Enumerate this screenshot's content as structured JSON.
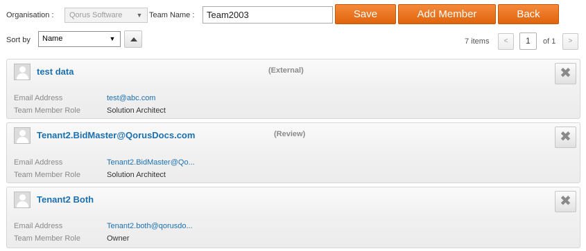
{
  "header": {
    "organisation_label": "Organisation :",
    "organisation_value": "Qorus Software",
    "team_name_label": "Team Name :",
    "team_name_value": "Team2003",
    "save_label": "Save",
    "add_member_label": "Add Member",
    "back_label": "Back"
  },
  "sort": {
    "label": "Sort by",
    "selected": "Name",
    "direction_icon": "triangle-up-icon"
  },
  "pagination": {
    "items_text": "7 items",
    "prev_label": "<",
    "current_page": "1",
    "of_text": "of 1",
    "next_label": ">"
  },
  "field_labels": {
    "email": "Email Address",
    "role": "Team Member Role"
  },
  "members": [
    {
      "name": "test data",
      "tag": "(External)",
      "email": "test@abc.com",
      "role": "Solution Architect"
    },
    {
      "name": "Tenant2.BidMaster@QorusDocs.com",
      "tag": "(Review)",
      "email": "Tenant2.BidMaster@Qo...",
      "role": "Solution Architect"
    },
    {
      "name": "Tenant2 Both",
      "tag": "",
      "email": "Tenant2.both@qorusdo...",
      "role": "Owner"
    }
  ],
  "colors": {
    "accent_button": "#e8731d",
    "link": "#1b70b0",
    "muted_text": "#8a8a8a"
  },
  "icons": {
    "avatar": "user-silhouette-icon",
    "delete": "close-x-icon"
  }
}
